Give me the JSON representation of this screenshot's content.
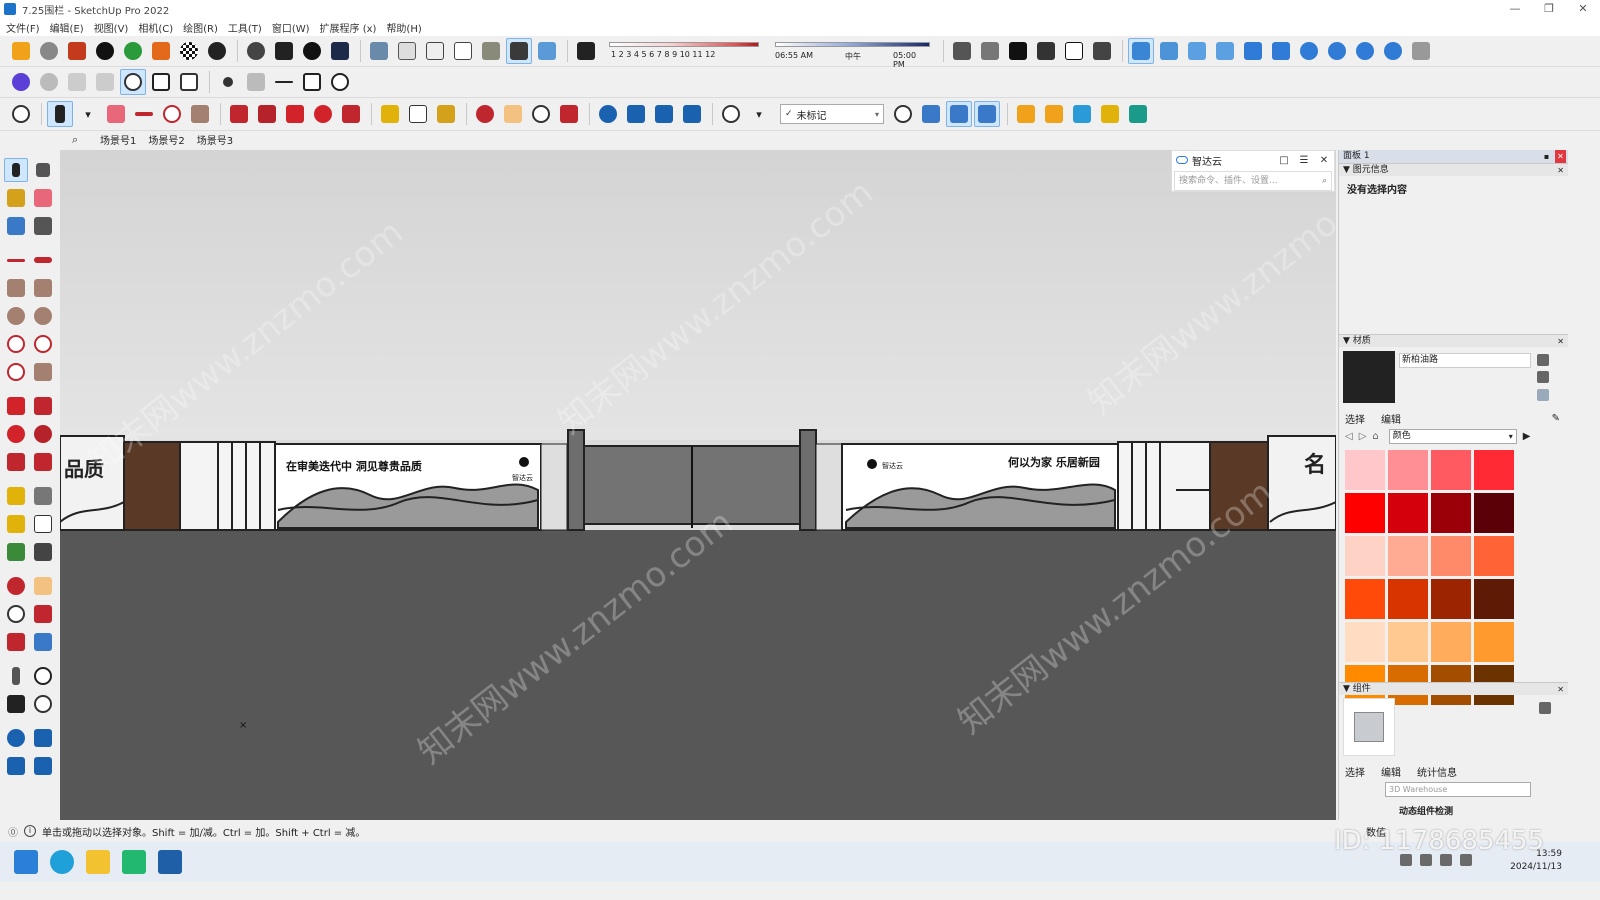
{
  "window": {
    "title": "7.25围栏 - SketchUp Pro 2022",
    "controls": [
      "—",
      "❐",
      "✕"
    ]
  },
  "menu": [
    "文件(F)",
    "编辑(E)",
    "视图(V)",
    "相机(C)",
    "绘图(R)",
    "工具(T)",
    "窗口(W)",
    "扩展程序 (x)",
    "帮助(H)"
  ],
  "shadow": {
    "months": "1 2 3 4 5 6 7 8 9 10 11 12",
    "time_start": "06:55 AM",
    "time_mid": "中午",
    "time_end": "05:00 PM"
  },
  "tag_select": "未标记",
  "scenes": [
    "场景号1",
    "场景号2",
    "场景号3"
  ],
  "viewport": {
    "fence_text_left": "在审美迭代中  洞见尊贵品质",
    "fence_text_right": "何以为家  乐居新园",
    "big_char_left": "品质",
    "big_char_right": "名",
    "brand_left": "智达云",
    "brand_right": "智达云",
    "watermark": "知末网www.znzmo.com"
  },
  "zhidayun": {
    "title": "智达云",
    "search_placeholder": "搜索命令、插件、设置..."
  },
  "tray": {
    "title": "面板 1",
    "entity_info": {
      "heading": "图元信息",
      "empty_text": "没有选择内容"
    },
    "materials": {
      "heading": "材质",
      "current_name": "新柏油路",
      "tab_select": "选择",
      "tab_edit": "编辑",
      "library": "颜色",
      "swatches": [
        "#ffc7c9",
        "#ff8f94",
        "#ff5a62",
        "#ff2a34",
        "#ff0000",
        "#d4000b",
        "#9b0009",
        "#5c0007",
        "#ffd2c6",
        "#ffab94",
        "#ff8a69",
        "#ff6336",
        "#ff4a0a",
        "#d63500",
        "#9c2400",
        "#5e1a04",
        "#ffdcc2",
        "#ffc991",
        "#ffad5c",
        "#ff9a2e",
        "#ff8a00",
        "#d96c00",
        "#a24d00",
        "#6a3300"
      ]
    },
    "components": {
      "heading": "组件",
      "tab_select": "选择",
      "tab_edit": "编辑",
      "tab_stats": "统计信息",
      "search_placeholder": "3D Warehouse",
      "partial_label": "动态组件检测"
    }
  },
  "status": {
    "hint": "单击或拖动以选择对象。Shift = 加/减。Ctrl = 加。Shift + Ctrl = 减。",
    "measure_label": "数值"
  },
  "taskbar": {
    "time": "13:59",
    "date": "2024/11/13"
  },
  "overlay": {
    "id_text": "ID: 1178685455"
  },
  "colors": {
    "accent": "#1c73c9",
    "ground": "#575757",
    "fence_frame": "#6e6e6e",
    "gate": "#737373",
    "wood": "#5a3a26"
  }
}
